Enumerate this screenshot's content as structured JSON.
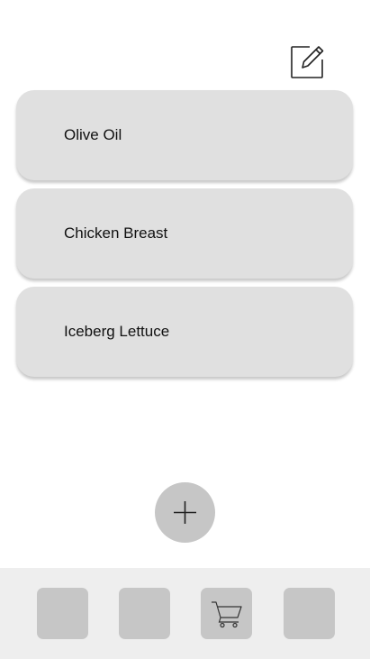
{
  "header": {
    "edit_icon": "edit-icon"
  },
  "items": [
    {
      "label": "Olive Oil"
    },
    {
      "label": "Chicken Breast"
    },
    {
      "label": "Iceberg Lettuce"
    }
  ],
  "fab": {
    "icon": "plus-icon"
  },
  "bottom_nav": {
    "buttons": [
      {
        "icon": ""
      },
      {
        "icon": ""
      },
      {
        "icon": "cart-icon"
      },
      {
        "icon": ""
      }
    ]
  },
  "colors": {
    "card_bg": "#e0e0e0",
    "button_bg": "#c6c6c6",
    "bottom_bar_bg": "#eeeeee",
    "text": "#111111"
  }
}
